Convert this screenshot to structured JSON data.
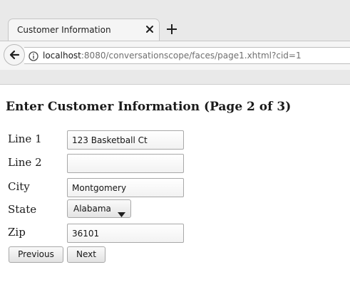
{
  "browser": {
    "tab": {
      "title": "Customer Information"
    },
    "address_bar": {
      "host": "localhost",
      "rest": ":8080/conversationscope/faces/page1.xhtml?cid=1"
    }
  },
  "page": {
    "title": "Enter Customer Information (Page 2 of 3)",
    "form": {
      "line1": {
        "label": "Line 1",
        "value": "123 Basketball Ct"
      },
      "line2": {
        "label": "Line 2",
        "value": ""
      },
      "city": {
        "label": "City",
        "value": "Montgomery"
      },
      "state": {
        "label": "State",
        "value": "Alabama"
      },
      "zip": {
        "label": "Zip",
        "value": "36101"
      }
    },
    "buttons": {
      "previous": "Previous",
      "next": "Next"
    }
  },
  "icons": {
    "back": "back-arrow-icon",
    "info": "info-icon",
    "close": "close-icon",
    "new_tab": "plus-icon",
    "dropdown": "chevron-down-icon"
  }
}
